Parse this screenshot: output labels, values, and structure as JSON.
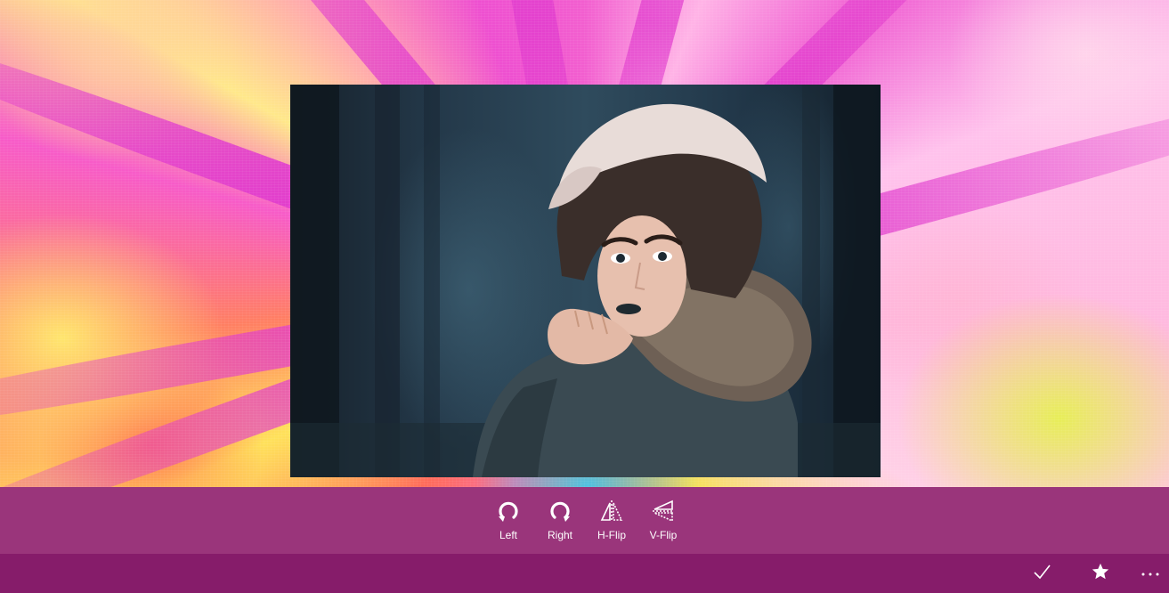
{
  "toolbar": {
    "tools": [
      {
        "label": "Left",
        "icon": "rotate-left-icon"
      },
      {
        "label": "Right",
        "icon": "rotate-right-icon"
      },
      {
        "label": "H-Flip",
        "icon": "flip-horizontal-icon"
      },
      {
        "label": "V-Flip",
        "icon": "flip-vertical-icon"
      }
    ]
  },
  "command_bar": {
    "items": [
      {
        "icon": "checkmark-icon",
        "glyph": "✓"
      },
      {
        "icon": "star-icon",
        "glyph": "★"
      },
      {
        "icon": "more-icon",
        "glyph": "···"
      }
    ]
  },
  "colors": {
    "toolbar_bg": "#9a357b",
    "command_bar_bg": "#861c6a",
    "icon_color": "#ffffff"
  }
}
